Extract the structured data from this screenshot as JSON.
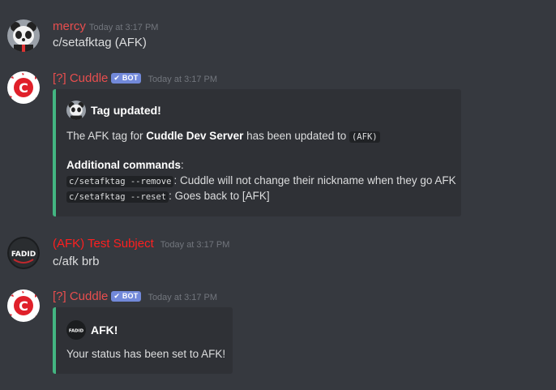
{
  "messages": [
    {
      "username": "mercy",
      "timestamp": "Today at 3:17 PM",
      "avatar": "panda-avatar",
      "text": "c/setafktag (AFK)"
    },
    {
      "username": "[?] Cuddle",
      "badge": "✔ BOT",
      "timestamp": "Today at 3:17 PM",
      "avatar": "cuddle-bot-avatar",
      "embed": {
        "color": "#43b581",
        "author_name": "Tag updated!",
        "line1_pre": "The AFK tag for ",
        "line1_bold": "Cuddle Dev Server",
        "line1_mid": " has been updated to ",
        "line1_code": "(AFK)",
        "additional_heading": "Additional commands",
        "additional_colon": ":",
        "cmd1_code": "c/setafktag --remove",
        "cmd1_desc": ": Cuddle will not change their nickname when they go AFK",
        "cmd2_code": "c/setafktag --reset",
        "cmd2_desc": ": Goes back to [AFK]"
      }
    },
    {
      "username": "(AFK) Test Subject",
      "timestamp": "Today at 3:17 PM",
      "avatar": "fadid-avatar",
      "avatar_text": "FADID",
      "text": "c/afk brb"
    },
    {
      "username": "[?] Cuddle",
      "badge": "✔ BOT",
      "timestamp": "Today at 3:17 PM",
      "avatar": "cuddle-bot-avatar",
      "embed": {
        "color": "#43b581",
        "author_name": "AFK!",
        "author_icon_text": "FADID",
        "line1": "Your status has been set to AFK!"
      }
    }
  ],
  "colors": {
    "background": "#36393f",
    "embed_background": "#2f3136",
    "username_red": "#e84e4e",
    "bot_badge": "#7289da"
  }
}
